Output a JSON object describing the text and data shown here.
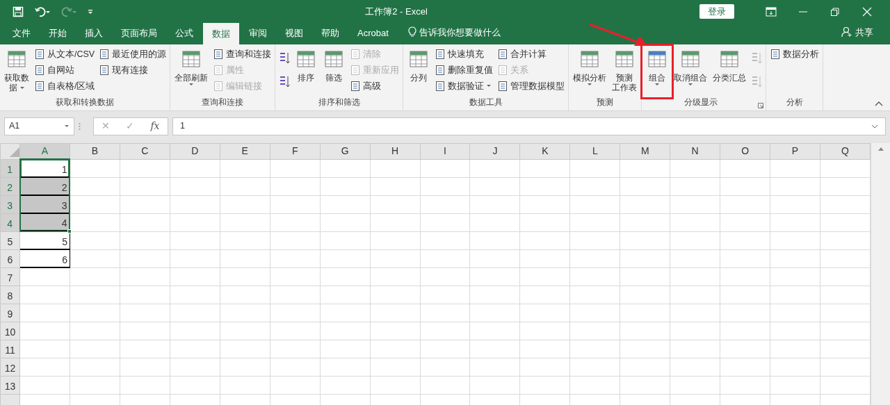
{
  "window": {
    "title": "工作簿2  -  Excel",
    "login": "登录"
  },
  "tabs": [
    {
      "label": "文件",
      "selected": false
    },
    {
      "label": "开始",
      "selected": false
    },
    {
      "label": "插入",
      "selected": false
    },
    {
      "label": "页面布局",
      "selected": false
    },
    {
      "label": "公式",
      "selected": false
    },
    {
      "label": "数据",
      "selected": true
    },
    {
      "label": "审阅",
      "selected": false
    },
    {
      "label": "视图",
      "selected": false
    },
    {
      "label": "帮助",
      "selected": false
    },
    {
      "label": "Acrobat",
      "selected": false
    }
  ],
  "tell_me": "告诉我你想要做什么",
  "share": "共享",
  "ribbon_groups": [
    {
      "label": "获取和转换数据",
      "sections": [
        {
          "kind": "large",
          "lines": [
            "获取数",
            "据"
          ],
          "dropdown": true
        },
        {
          "kind": "stack",
          "items": [
            {
              "label": "从文本/CSV",
              "disabled": false
            },
            {
              "label": "自网站",
              "disabled": false
            },
            {
              "label": "自表格/区域",
              "disabled": false
            }
          ]
        },
        {
          "kind": "stack",
          "items": [
            {
              "label": "最近使用的源",
              "disabled": false
            },
            {
              "label": "现有连接",
              "disabled": false
            }
          ]
        }
      ]
    },
    {
      "label": "查询和连接",
      "sections": [
        {
          "kind": "large",
          "lines": [
            "全部刷新"
          ],
          "dropdown": true
        },
        {
          "kind": "stack",
          "items": [
            {
              "label": "查询和连接",
              "disabled": false
            },
            {
              "label": "属性",
              "disabled": true
            },
            {
              "label": "编辑链接",
              "disabled": true
            }
          ]
        }
      ]
    },
    {
      "label": "排序和筛选",
      "sections": [
        {
          "kind": "stack",
          "items": [
            {
              "disabled": false
            },
            {
              "disabled": false
            }
          ]
        },
        {
          "kind": "large",
          "lines": [
            "排序"
          ]
        },
        {
          "kind": "large",
          "lines": [
            "筛选"
          ]
        },
        {
          "kind": "stack",
          "items": [
            {
              "label": "清除",
              "disabled": true
            },
            {
              "label": "重新应用",
              "disabled": true
            },
            {
              "label": "高级",
              "disabled": false
            }
          ]
        }
      ]
    },
    {
      "label": "数据工具",
      "sections": [
        {
          "kind": "large",
          "lines": [
            "分列"
          ]
        },
        {
          "kind": "stack",
          "items": [
            {
              "label": "快速填充",
              "disabled": false
            },
            {
              "label": "删除重复值",
              "disabled": false
            },
            {
              "label": "数据验证",
              "disabled": false,
              "dropdown": true
            }
          ]
        },
        {
          "kind": "stack",
          "items": [
            {
              "label": "合并计算",
              "disabled": false
            },
            {
              "label": "关系",
              "disabled": true
            },
            {
              "label": "管理数据模型",
              "disabled": false
            }
          ]
        }
      ]
    },
    {
      "label": "预测",
      "sections": [
        {
          "kind": "large",
          "lines": [
            "模拟分析"
          ],
          "dropdown": true
        },
        {
          "kind": "large",
          "lines": [
            "预测",
            "工作表"
          ]
        }
      ]
    },
    {
      "label": "分级显示",
      "launcher": true,
      "sections": [
        {
          "kind": "large",
          "lines": [
            "组合"
          ],
          "dropdown": true,
          "highlighted": true
        },
        {
          "kind": "large",
          "lines": [
            "取消组合"
          ],
          "dropdown": true
        },
        {
          "kind": "large",
          "lines": [
            "分类汇总"
          ]
        },
        {
          "kind": "stack",
          "items": [
            {
              "disabled": true
            },
            {
              "disabled": true
            }
          ]
        }
      ]
    },
    {
      "label": "分析",
      "sections": [
        {
          "kind": "stack",
          "items": [
            {
              "label": "数据分析",
              "disabled": false
            }
          ]
        }
      ]
    }
  ],
  "annotation_arrow": true,
  "formula_bar": {
    "name_box": "A1",
    "buttons": [
      "✕",
      "✓",
      "fx"
    ],
    "value": "1"
  },
  "columns": [
    {
      "label": "A",
      "selected": true
    },
    {
      "label": "B",
      "selected": false
    },
    {
      "label": "C",
      "selected": false
    },
    {
      "label": "D",
      "selected": false
    },
    {
      "label": "E",
      "selected": false
    },
    {
      "label": "F",
      "selected": false
    },
    {
      "label": "G",
      "selected": false
    },
    {
      "label": "H",
      "selected": false
    },
    {
      "label": "I",
      "selected": false
    },
    {
      "label": "J",
      "selected": false
    },
    {
      "label": "K",
      "selected": false
    },
    {
      "label": "L",
      "selected": false
    },
    {
      "label": "M",
      "selected": false
    },
    {
      "label": "N",
      "selected": false
    },
    {
      "label": "O",
      "selected": false
    },
    {
      "label": "P",
      "selected": false
    },
    {
      "label": "Q",
      "selected": false
    }
  ],
  "rows": [
    {
      "label": "1",
      "selected": true,
      "cells": [
        {
          "value": "1",
          "selected": true,
          "active": true,
          "bordered": true
        }
      ]
    },
    {
      "label": "2",
      "selected": true,
      "cells": [
        {
          "value": "2",
          "selected": true,
          "active": false,
          "bordered": true
        }
      ]
    },
    {
      "label": "3",
      "selected": true,
      "cells": [
        {
          "value": "3",
          "selected": true,
          "active": false,
          "bordered": true
        }
      ]
    },
    {
      "label": "4",
      "selected": true,
      "cells": [
        {
          "value": "4",
          "selected": true,
          "active": false,
          "bordered": true
        }
      ]
    },
    {
      "label": "5",
      "selected": false,
      "cells": [
        {
          "value": "5",
          "selected": false,
          "active": false,
          "bordered": true
        }
      ]
    },
    {
      "label": "6",
      "selected": false,
      "cells": [
        {
          "value": "6",
          "selected": false,
          "active": false,
          "bordered": true
        }
      ]
    },
    {
      "label": "7",
      "selected": false,
      "cells": []
    },
    {
      "label": "8",
      "selected": false,
      "cells": []
    },
    {
      "label": "9",
      "selected": false,
      "cells": []
    },
    {
      "label": "10",
      "selected": false,
      "cells": []
    },
    {
      "label": "11",
      "selected": false,
      "cells": []
    },
    {
      "label": "12",
      "selected": false,
      "cells": []
    },
    {
      "label": "13",
      "selected": false,
      "cells": []
    }
  ]
}
